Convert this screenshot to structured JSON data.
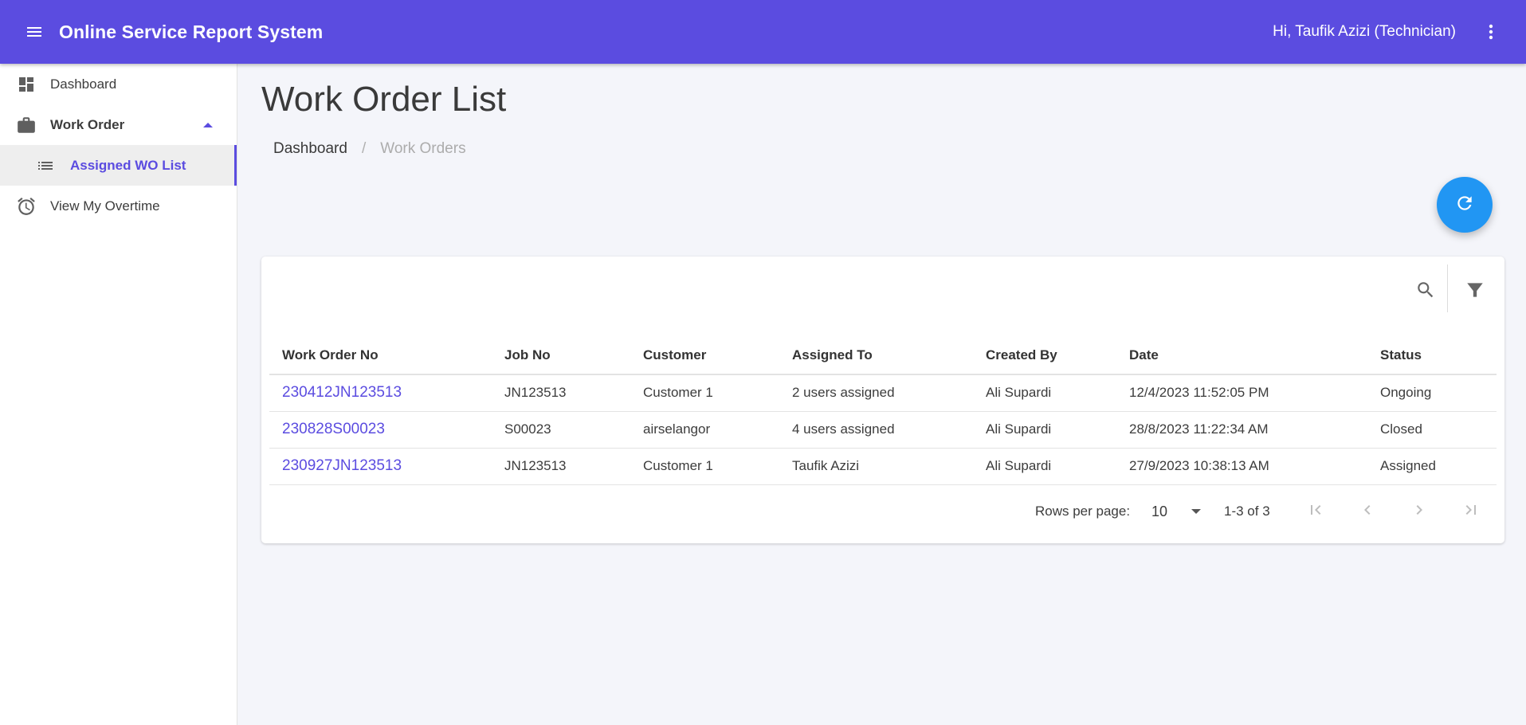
{
  "appbar": {
    "title": "Online Service Report System",
    "greeting": "Hi, Taufik Azizi (Technician)",
    "menu_icon": "hamburger-menu-icon",
    "more_icon": "more-vert-icon",
    "color": "#5b4ce0"
  },
  "sidebar": {
    "items": [
      {
        "label": "Dashboard",
        "icon": "dashboard-icon"
      },
      {
        "label": "Work Order",
        "icon": "briefcase-icon",
        "expanded": true
      },
      {
        "label": "Assigned WO List",
        "icon": "list-icon",
        "active": true
      },
      {
        "label": "View My Overtime",
        "icon": "alarm-clock-icon"
      }
    ]
  },
  "page": {
    "title": "Work Order List",
    "breadcrumb": {
      "link": "Dashboard",
      "separator": "/",
      "current": "Work Orders"
    },
    "refresh_icon": "refresh-icon"
  },
  "table": {
    "toolbar": {
      "search_icon": "search-icon",
      "filter_icon": "filter-icon"
    },
    "columns": [
      "Work Order No",
      "Job No",
      "Customer",
      "Assigned To",
      "Created By",
      "Date",
      "Status"
    ],
    "rows": [
      {
        "wo": "230412JN123513",
        "job": "JN123513",
        "customer": "Customer 1",
        "assigned": "2 users assigned",
        "created_by": "Ali Supardi",
        "date": "12/4/2023 11:52:05 PM",
        "status": "Ongoing"
      },
      {
        "wo": "230828S00023",
        "job": "S00023",
        "customer": "airselangor",
        "assigned": "4 users assigned",
        "created_by": "Ali Supardi",
        "date": "28/8/2023 11:22:34 AM",
        "status": "Closed"
      },
      {
        "wo": "230927JN123513",
        "job": "JN123513",
        "customer": "Customer 1",
        "assigned": "Taufik Azizi",
        "created_by": "Ali Supardi",
        "date": "27/9/2023 10:38:13 AM",
        "status": "Assigned"
      }
    ],
    "pagination": {
      "rows_per_page_label": "Rows per page:",
      "rows_per_page": "10",
      "range": "1-3 of 3"
    }
  }
}
